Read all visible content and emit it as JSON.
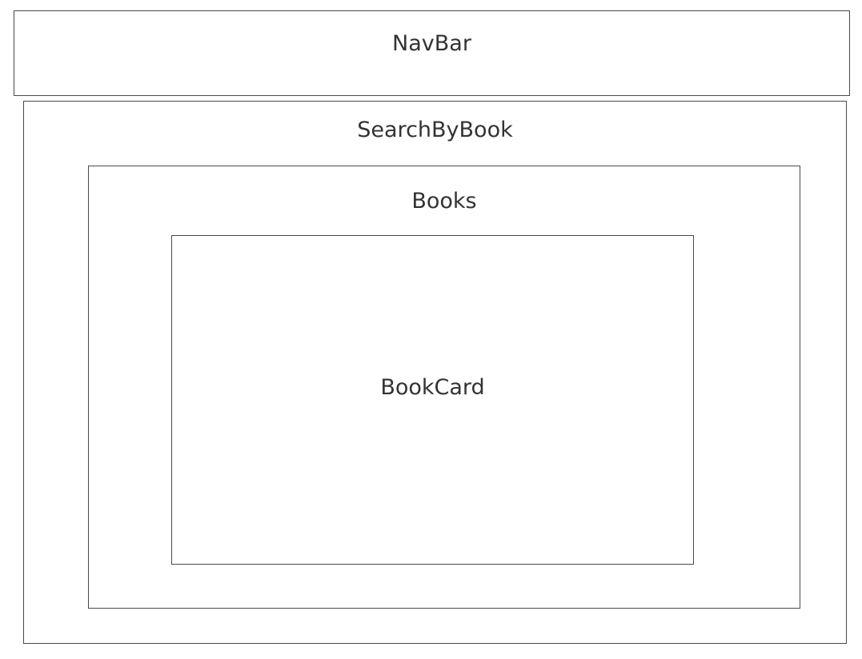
{
  "diagram": {
    "components": [
      {
        "id": "navbar",
        "label": "NavBar"
      },
      {
        "id": "searchbybook",
        "label": "SearchByBook",
        "children": [
          "books"
        ]
      },
      {
        "id": "books",
        "label": "Books",
        "children": [
          "bookcard"
        ]
      },
      {
        "id": "bookcard",
        "label": "BookCard"
      }
    ],
    "navbar": {
      "label": "NavBar"
    },
    "searchbybook": {
      "label": "SearchByBook"
    },
    "books": {
      "label": "Books"
    },
    "bookcard": {
      "label": "BookCard"
    }
  }
}
